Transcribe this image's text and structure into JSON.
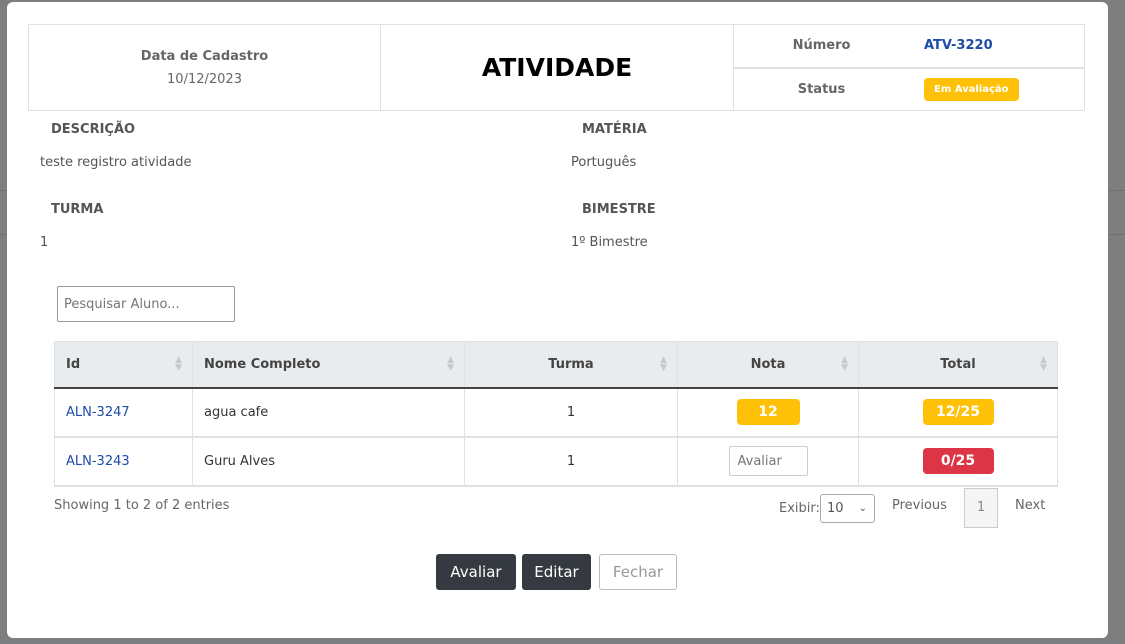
{
  "header": {
    "date_label": "Data de Cadastro",
    "date_value": "10/12/2023",
    "title": "ATIVIDADE",
    "numero_label": "Número",
    "numero_value": "ATV-3220",
    "status_label": "Status",
    "status_value": "Em Avaliação"
  },
  "fields": {
    "descricao_label": "DESCRIÇÃO",
    "descricao_value": "teste registro atividade",
    "materia_label": "MATÉRIA",
    "materia_value": "Português",
    "turma_label": "TURMA",
    "turma_value": "1",
    "bimestre_label": "BIMESTRE",
    "bimestre_value": "1º Bimestre"
  },
  "search": {
    "placeholder": "Pesquisar Aluno..."
  },
  "table": {
    "columns": [
      "Id",
      "Nome Completo",
      "Turma",
      "Nota",
      "Total"
    ],
    "rows": [
      {
        "id": "ALN-3247",
        "nome": "agua cafe",
        "turma": "1",
        "nota": "12",
        "total": "12/25"
      },
      {
        "id": "ALN-3243",
        "nome": "Guru Alves",
        "turma": "1",
        "nota_placeholder": "Avaliar",
        "total": "0/25"
      }
    ]
  },
  "footer": {
    "info": "Showing 1 to 2 of 2 entries",
    "exibir_label": "Exibir:",
    "page_size": "10",
    "previous": "Previous",
    "page": "1",
    "next": "Next"
  },
  "actions": {
    "avaliar": "Avaliar",
    "editar": "Editar",
    "fechar": "Fechar"
  },
  "colors": {
    "accent": "#1d4ba7",
    "warning": "#ffc107",
    "danger": "#dc3545",
    "dark": "#343a40"
  }
}
